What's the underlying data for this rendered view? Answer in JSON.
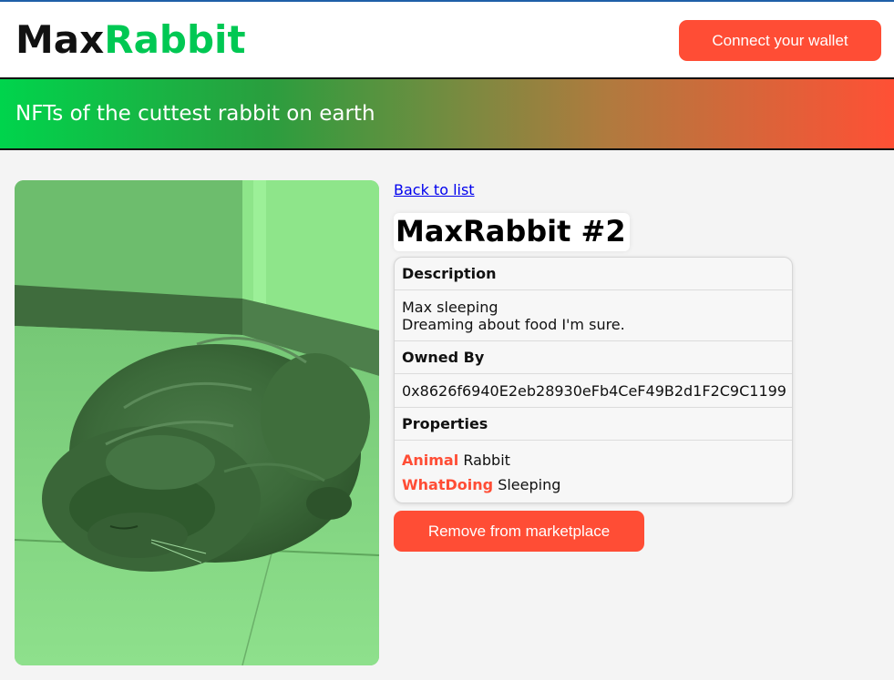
{
  "header": {
    "logo_part1": "Max",
    "logo_part2": "Rabbit",
    "connect_label": "Connect your wallet"
  },
  "banner": {
    "tagline": "NFTs of the cuttest rabbit on earth"
  },
  "nft": {
    "back_label": "Back to list",
    "title": "MaxRabbit #2",
    "description_heading": "Description",
    "description_line1": "Max sleeping",
    "description_line2": "Dreaming about food I'm sure.",
    "owner_heading": "Owned By",
    "owner_address": "0x8626f6940E2eb28930eFb4CeF49B2d1F2C9C1199",
    "properties_heading": "Properties",
    "properties": [
      {
        "key": "Animal",
        "value": "Rabbit"
      },
      {
        "key": "WhatDoing",
        "value": "Sleeping"
      }
    ],
    "remove_label": "Remove from marketplace"
  },
  "colors": {
    "accent": "#ff4d35",
    "brand_green": "#00c853",
    "photo_tint": "#6fd870"
  }
}
